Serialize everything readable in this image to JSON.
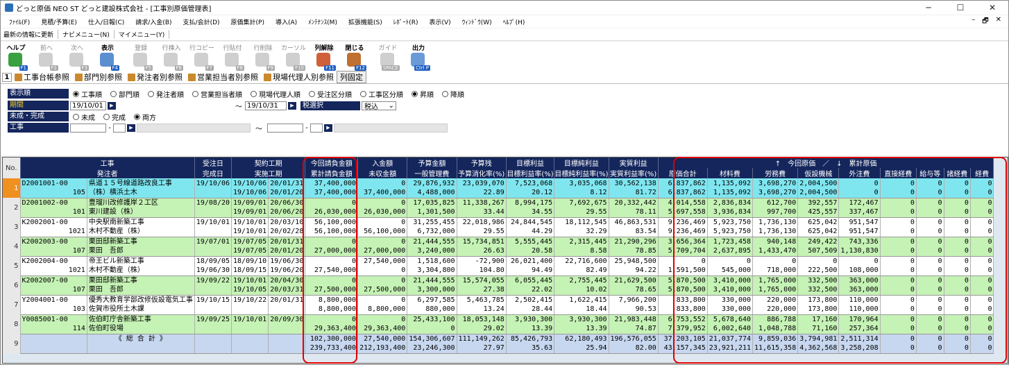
{
  "window": {
    "title": "どっと原価 NEO ST どっと建設株式会社 - [工事別原価管理表]",
    "min": "─",
    "max": "☐",
    "close": "✕"
  },
  "menu": [
    "ﾌｧｲﾙ(F)",
    "見積/予算(E)",
    "仕入/日報(C)",
    "請求/入金(B)",
    "支払/会計(D)",
    "原価集計(P)",
    "導入(A)",
    "ﾒﾝﾃﾅﾝｽ(M)",
    "拡張機能(S)",
    "ﾚﾎﾟｰﾄ(R)",
    "表示(V)",
    "ｳｨﾝﾄﾞｳ(W)",
    "ﾍﾙﾌﾟ(H)"
  ],
  "menu_right": [
    "–",
    "🗗",
    "✕"
  ],
  "subbar": [
    "最新の情報に更新",
    "ナビメニュー(N)",
    "マイメニュー(Y)"
  ],
  "toolbar": [
    {
      "label": "ヘルプ",
      "key": "F1",
      "icon": "help-icon",
      "color": "#3aa040",
      "enabled": true
    },
    {
      "label": "前へ",
      "key": "F2",
      "icon": "prev-icon",
      "color": "#ccc",
      "enabled": false
    },
    {
      "label": "次へ",
      "key": "F3",
      "icon": "next-icon",
      "color": "#ccc",
      "enabled": false
    },
    {
      "label": "表示",
      "key": "F4",
      "icon": "display-icon",
      "color": "#5b8fd0",
      "enabled": true
    },
    {
      "label": "登録",
      "key": "F5",
      "icon": "register-icon",
      "color": "#ccc",
      "enabled": false
    },
    {
      "label": "行挿入",
      "key": "F6",
      "icon": "insert-row-icon",
      "color": "#ccc",
      "enabled": false
    },
    {
      "label": "行コピー",
      "key": "F7",
      "icon": "copy-row-icon",
      "color": "#ccc",
      "enabled": false
    },
    {
      "label": "行貼付",
      "key": "F8",
      "icon": "paste-row-icon",
      "color": "#ccc",
      "enabled": false
    },
    {
      "label": "行削除",
      "key": "F9",
      "icon": "delete-row-icon",
      "color": "#ccc",
      "enabled": false
    },
    {
      "label": "カーソル",
      "key": "F10",
      "icon": "cursor-icon",
      "color": "#ccc",
      "enabled": false
    },
    {
      "label": "列解除",
      "key": "F11",
      "icon": "unfreeze-column-icon",
      "color": "#d0603a",
      "enabled": true
    },
    {
      "label": "閉じる",
      "key": "F12",
      "icon": "close-door-icon",
      "color": "#c07030",
      "enabled": true
    },
    {
      "label": "ガイド",
      "key": "SPACE",
      "icon": "guide-icon",
      "color": "#ccc",
      "enabled": false
    },
    {
      "label": "出力",
      "key": "Ctrl P",
      "icon": "output-icon",
      "color": "#6a9ad8",
      "enabled": true
    }
  ],
  "tabs": {
    "number": "1",
    "items": [
      "工事台帳参照",
      "部門別参照",
      "発注者別参照",
      "営業担当者別参照",
      "現場代理人別参照",
      "列固定"
    ]
  },
  "filters": {
    "order_label": "表示順",
    "order_options": [
      {
        "label": "工事順",
        "on": true
      },
      {
        "label": "部門順",
        "on": false
      },
      {
        "label": "発注者順",
        "on": false
      },
      {
        "label": "営業担当者順",
        "on": false
      },
      {
        "label": "現場代理人順",
        "on": false
      },
      {
        "label": "受注区分順",
        "on": false
      },
      {
        "label": "工事区分順",
        "on": false
      },
      {
        "label": "昇順",
        "on": true
      },
      {
        "label": "降順",
        "on": false
      }
    ],
    "period_label": "期間",
    "period_from": "19/10/01",
    "period_to": "19/10/31",
    "tilde": "～",
    "tax_label": "税選択",
    "tax_value": "税込",
    "status_label": "未成・完成",
    "status_options": [
      {
        "label": "未成",
        "on": false
      },
      {
        "label": "完成",
        "on": false
      },
      {
        "label": "両方",
        "on": true
      }
    ],
    "kouji_label": "工事",
    "dash": "-"
  },
  "grid": {
    "headers_top": [
      "No.",
      "工事",
      "受注日",
      "契約工期",
      "今回請負金額",
      "入金額",
      "予算金額",
      "予算残",
      "目標利益",
      "目標純利益",
      "実質利益",
      "↑　今回原価　／　↓　累計原価"
    ],
    "headers_bot": [
      "発注者",
      "完成日",
      "実施工期",
      "累計請負金額",
      "未収金額",
      "一般管理費",
      "予算消化率(%)",
      "目標利益率(%)",
      "目標純利益率(%)",
      "実質利益率(%)",
      "原価合計",
      "材料費",
      "労務費",
      "仮設機械",
      "外注費",
      "直接経費",
      "給与等",
      "諸経費",
      "経費"
    ],
    "rows": [
      {
        "no": "1",
        "style": "cyan",
        "sel": true,
        "a": [
          "D2001001-00",
          "県道１５号線道路改良工事",
          "19/10/06",
          "19/10/06",
          "20/01/31",
          "37,400,000",
          "0",
          "29,876,932",
          "23,039,070",
          "7,523,068",
          "3,035,068",
          "30,562,138",
          "6,837,862",
          "1,135,092",
          "3,698,270",
          "2,004,500",
          "0",
          "0",
          "0",
          "0",
          "0"
        ],
        "b": [
          "105",
          "（株）横浜土木",
          "",
          "19/10/06",
          "20/01/20",
          "37,400,000",
          "37,400,000",
          "4,488,000",
          "22.89",
          "20.12",
          "8.12",
          "81.72",
          "6,837,862",
          "1,135,092",
          "3,698,270",
          "2,004,500",
          "0",
          "0",
          "0",
          "0",
          "0"
        ]
      },
      {
        "no": "2",
        "style": "green",
        "sel": false,
        "a": [
          "D2001002-00",
          "豊瑠川改修護岸２工区",
          "19/08/20",
          "19/09/01",
          "20/06/30",
          "0",
          "0",
          "17,035,825",
          "11,338,267",
          "8,994,175",
          "7,692,675",
          "20,332,442",
          "4,014,558",
          "2,836,834",
          "612,700",
          "392,557",
          "172,467",
          "0",
          "0",
          "0",
          "0"
        ],
        "b": [
          "101",
          "東川建設（株）",
          "",
          "19/09/01",
          "20/06/20",
          "26,030,000",
          "26,030,000",
          "1,301,500",
          "33.44",
          "34.55",
          "29.55",
          "78.11",
          "5,697,558",
          "3,936,834",
          "997,700",
          "425,557",
          "337,467",
          "0",
          "0",
          "0",
          "0"
        ]
      },
      {
        "no": "3",
        "style": "white",
        "sel": false,
        "a": [
          "K2002001-00",
          "中央駅南新築工事",
          "19/10/01",
          "19/10/01",
          "20/03/10",
          "56,100,000",
          "0",
          "31,255,455",
          "22,018,986",
          "24,844,545",
          "18,112,545",
          "46,863,531",
          "9,236,469",
          "5,923,750",
          "1,736,130",
          "625,042",
          "951,547",
          "0",
          "0",
          "0",
          "0"
        ],
        "b": [
          "1021",
          "木村不動産（株）",
          "",
          "19/10/01",
          "20/02/28",
          "56,100,000",
          "56,100,000",
          "6,732,000",
          "29.55",
          "44.29",
          "32.29",
          "83.54",
          "9,236,469",
          "5,923,750",
          "1,736,130",
          "625,042",
          "951,547",
          "0",
          "0",
          "0",
          "0"
        ]
      },
      {
        "no": "4",
        "style": "green",
        "sel": false,
        "a": [
          "K2002003-00",
          "栗田邸新築工事",
          "19/07/01",
          "19/07/05",
          "20/01/31",
          "0",
          "0",
          "21,444,555",
          "15,734,851",
          "5,555,445",
          "2,315,445",
          "21,290,296",
          "3,656,364",
          "1,723,458",
          "940,148",
          "249,422",
          "743,336",
          "0",
          "0",
          "0",
          "0"
        ],
        "b": [
          "107",
          "栗田　吾郎",
          "",
          "19/07/05",
          "20/01/20",
          "27,000,000",
          "27,000,000",
          "3,240,000",
          "26.63",
          "20.58",
          "8.58",
          "78.85",
          "5,709,704",
          "2,637,895",
          "1,433,470",
          "507,509",
          "1,130,830",
          "0",
          "0",
          "0",
          "0"
        ]
      },
      {
        "no": "5",
        "style": "white",
        "sel": false,
        "a": [
          "K2002004-00",
          "帝王ビル新築工事",
          "18/09/05",
          "18/09/10",
          "19/06/30",
          "0",
          "27,540,000",
          "1,518,600",
          "-72,900",
          "26,021,400",
          "22,716,600",
          "25,948,500",
          "0",
          "0",
          "0",
          "0",
          "0",
          "0",
          "0",
          "0",
          "0"
        ],
        "b": [
          "1021",
          "木村不動産（株）",
          "19/06/30",
          "18/09/15",
          "19/06/20",
          "27,540,000",
          "0",
          "3,304,800",
          "104.80",
          "94.49",
          "82.49",
          "94.22",
          "1,591,500",
          "545,000",
          "718,000",
          "222,500",
          "108,000",
          "0",
          "0",
          "0",
          "0"
        ]
      },
      {
        "no": "6",
        "style": "green",
        "sel": false,
        "a": [
          "K2002007-00",
          "栗田邸新築工事",
          "19/09/22",
          "19/10/01",
          "20/04/30",
          "0",
          "0",
          "21,444,555",
          "15,574,055",
          "6,055,445",
          "2,755,445",
          "21,629,500",
          "5,870,500",
          "3,410,000",
          "1,765,000",
          "332,500",
          "363,000",
          "0",
          "0",
          "0",
          "0"
        ],
        "b": [
          "107",
          "栗田　吾郎",
          "",
          "19/10/05",
          "20/03/31",
          "27,500,000",
          "27,500,000",
          "3,300,000",
          "27.38",
          "22.02",
          "10.02",
          "78.65",
          "5,870,500",
          "3,410,000",
          "1,765,000",
          "332,500",
          "363,000",
          "0",
          "0",
          "0",
          "0"
        ]
      },
      {
        "no": "7",
        "style": "white",
        "sel": false,
        "a": [
          "Y2004001-00",
          "優秀大教育学部改修仮設電気工事",
          "19/10/15",
          "19/10/22",
          "20/01/31",
          "8,800,000",
          "0",
          "6,297,585",
          "5,463,785",
          "2,502,415",
          "1,622,415",
          "7,966,200",
          "833,800",
          "330,000",
          "220,000",
          "173,800",
          "110,000",
          "0",
          "0",
          "0",
          "0"
        ],
        "b": [
          "103",
          "佐賀市役所土木課",
          "",
          "",
          "",
          "8,800,000",
          "8,800,000",
          "880,000",
          "13.24",
          "28.44",
          "18.44",
          "90.53",
          "833,800",
          "330,000",
          "220,000",
          "173,800",
          "110,000",
          "0",
          "0",
          "0",
          "0"
        ]
      },
      {
        "no": "8",
        "style": "green",
        "sel": false,
        "a": [
          "Y0085001-00",
          "佐伯町庁舎新築工事",
          "19/09/25",
          "19/10/01",
          "20/09/30",
          "0",
          "0",
          "25,433,100",
          "18,053,148",
          "3,930,300",
          "3,930,300",
          "21,983,448",
          "6,753,552",
          "5,678,640",
          "886,788",
          "17,160",
          "170,964",
          "0",
          "0",
          "0",
          "0"
        ],
        "b": [
          "114",
          "佐伯町役場",
          "",
          "",
          "",
          "29,363,400",
          "29,363,400",
          "0",
          "29.02",
          "13.39",
          "13.39",
          "74.87",
          "7,379,952",
          "6,002,640",
          "1,048,788",
          "71,160",
          "257,364",
          "0",
          "0",
          "0",
          "0"
        ]
      },
      {
        "no": "9",
        "style": "total",
        "sel": false,
        "a": [
          "",
          "《 総 合 計 》",
          "",
          "",
          "",
          "102,300,000",
          "27,540,000",
          "154,306,607",
          "111,149,262",
          "85,426,793",
          "62,180,493",
          "196,576,055",
          "37,203,105",
          "21,037,774",
          "9,859,036",
          "3,794,981",
          "2,511,314",
          "0",
          "0",
          "0",
          "0"
        ],
        "b": [
          "",
          "",
          "",
          "",
          "",
          "239,733,400",
          "212,193,400",
          "23,246,300",
          "27.97",
          "35.63",
          "25.94",
          "82.00",
          "43,157,345",
          "23,921,211",
          "11,615,358",
          "4,362,568",
          "3,258,208",
          "0",
          "0",
          "0",
          "0"
        ]
      }
    ]
  },
  "colors": {
    "header_navy": "#14265c",
    "row_cyan": "#7fe6f0",
    "row_green": "#c5f2b5",
    "total_blue": "#c7d7ef",
    "highlight_red": "#e00000",
    "selected_orange": "#f09020"
  }
}
